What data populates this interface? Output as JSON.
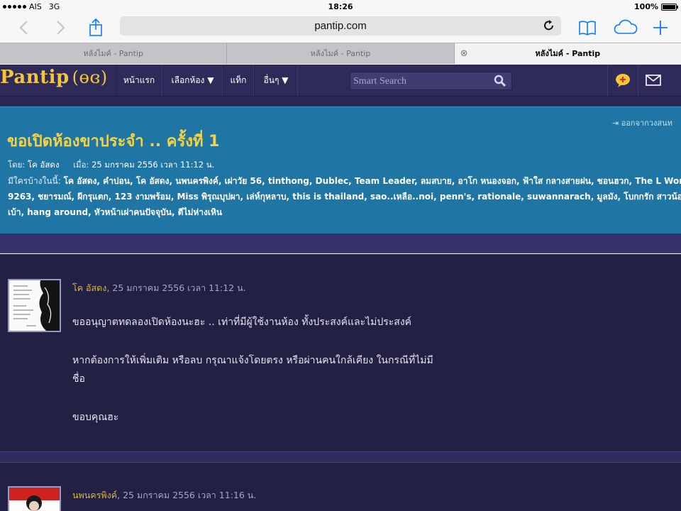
{
  "status_bar": {
    "carrier": "AIS",
    "network": "3G",
    "time": "18:26",
    "battery": "100%"
  },
  "toolbar": {
    "url": "pantip.com",
    "icons": [
      "back-icon",
      "forward-icon",
      "share-icon",
      "reload-icon",
      "bookmarks-icon",
      "icloud-tabs-icon",
      "new-tab-icon"
    ]
  },
  "tabs": [
    {
      "label": "หลังไมค์ - Pantip",
      "active": false
    },
    {
      "label": "หลังไมค์ - Pantip",
      "active": false
    },
    {
      "label": "หลังไมค์ - Pantip",
      "active": true
    }
  ],
  "nav": {
    "logo": "Pantip",
    "items": [
      "หน้าแรก",
      "เลือกห้อง ▼",
      "แท็ก",
      "อื่นๆ ▼"
    ],
    "search_placeholder": "Smart Search",
    "colors": {
      "bar": "#2e2a5a",
      "logo": "#f3c637"
    }
  },
  "topic": {
    "leave_link": "ออกจากวงสนท",
    "title": "ขอเปิดห้องขาประจำ .. ครั้งที่ 1",
    "author_label": "โดย:",
    "author": "โค อัสดง",
    "date_label": "เมื่อ:",
    "date": "25 มกราคม 2556 เวลา 11:12 น.",
    "who_label": "มีใครบ้างในนี้:",
    "who_list": "โค อัสดง, คำปอน, โค อัสดง, นพนครพิงค์, เผ่าวัย 56, tinthong, Dublec, Team Leader, ลมสบาย, อาโก หนองจอก, ฟ้าใส กลางสายฝน, ชอนฮวก, The L Word, YL. Jampoon, csom 9263, ชยารมณ์, ผีกรุแตก, 123 งามพร้อม, Miss พิรุณบุปผา, เล่ห์กุหลาบ, this is thailand, sao..เหลือ..noi, penn's, rationale, suwannarach, มูลมัง, โบกกรัก สาวน้อย..อารี่, จูงมือกันเดิน, หมากเบ้า, hang around, หัวหน้าเผ่าคนปัจจุบัน, ตีไม่ห่างเหิน",
    "colors": {
      "bg": "#1f76a5",
      "title": "#f6d23e"
    }
  },
  "posts": [
    {
      "user": "โค อัสดง",
      "timestamp": ", 25 มกราคม 2556 เวลา 11:12 น.",
      "lines": [
        "ขออนุญาตทดลองเปิดห้องนะฮะ .. เท่าที่มีผู้ใช้งานห้อง ทั้งประสงค์และไม่ประสงค์",
        "หากต้องการให้เพิ่มเติม หรือลบ กรุณาแจ้งโดยตรง หรือผ่านคนใกล้เคียง ในกรณีที่ไม่มีชื่อ",
        "ขอบคุณฮะ"
      ]
    },
    {
      "user": "นพนครพิงค์",
      "timestamp": ", 25 มกราคม 2556 เวลา 11:16 น.",
      "lines": []
    }
  ]
}
